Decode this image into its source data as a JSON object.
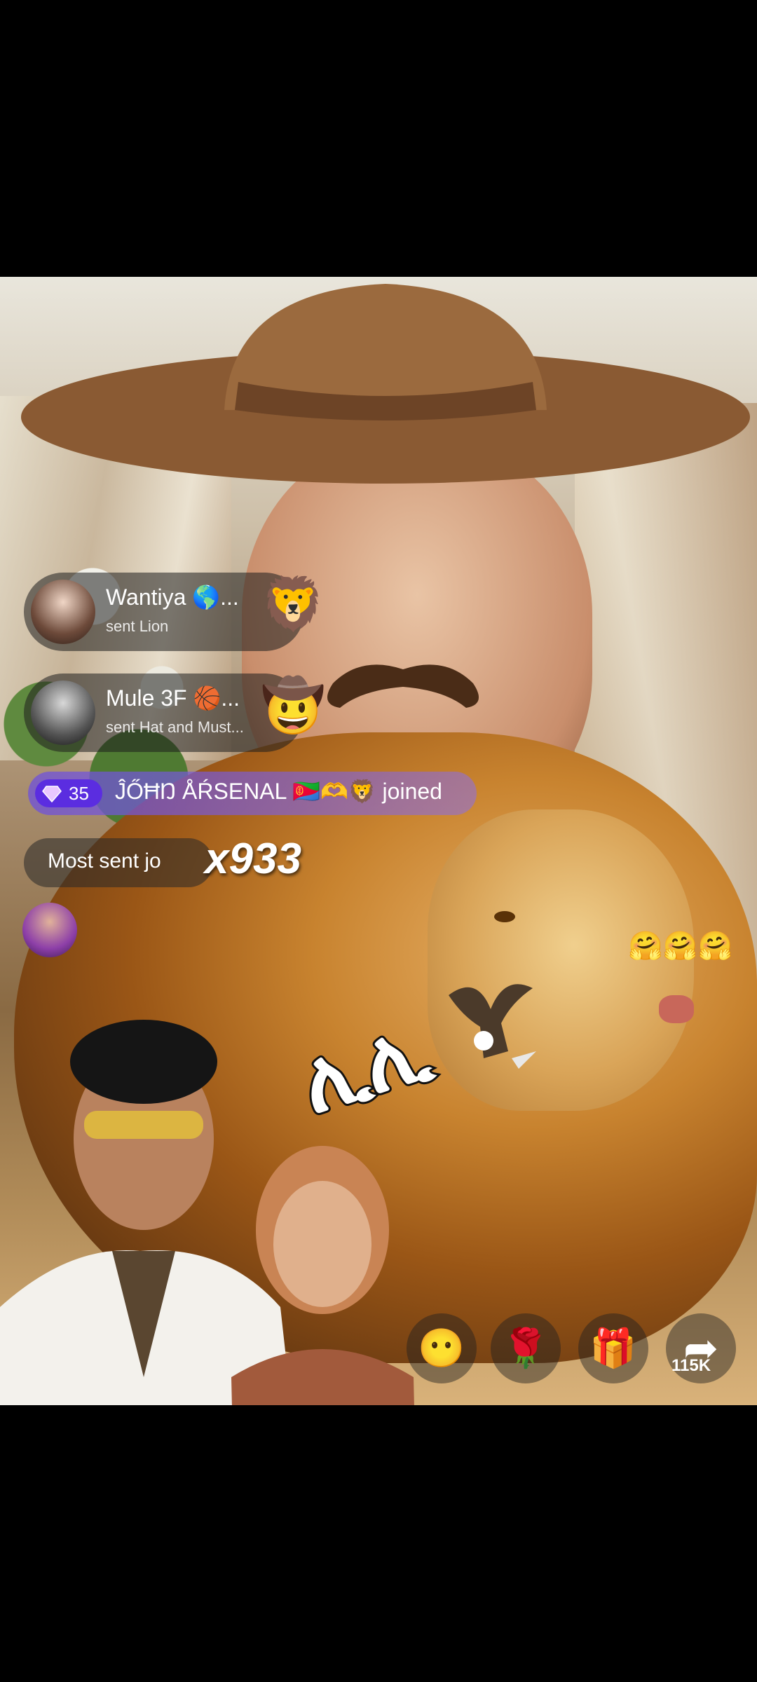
{
  "gift_feed": [
    {
      "name": "Wantiya 🌎...",
      "action": "sent Lion",
      "gift_icon": "lion-emoji",
      "gift_glyph": "🦁"
    },
    {
      "name": "Mule 3F 🏀...",
      "action": "sent Hat and Must...",
      "gift_icon": "cowboy-hat-emoji",
      "gift_glyph": "🤠"
    }
  ],
  "join_banner": {
    "level": "35",
    "text": "ĴŐĦŊ ÅŔSENAL 🇪🇷🫶🦁 joined",
    "badge_color": "#5b2de0"
  },
  "most_sent": {
    "label": "Most sent jo",
    "combo": "x933"
  },
  "reactions": {
    "hugs": "🤗🤗🤗"
  },
  "sticker_text": "ሊሊ",
  "actions": {
    "emoji": "😶",
    "rose": "🌹",
    "gift": "🎁",
    "share": "➦",
    "share_count": "115K"
  },
  "colors": {
    "accent": "#5b2de0",
    "overlay": "rgba(30,30,30,.55)"
  }
}
